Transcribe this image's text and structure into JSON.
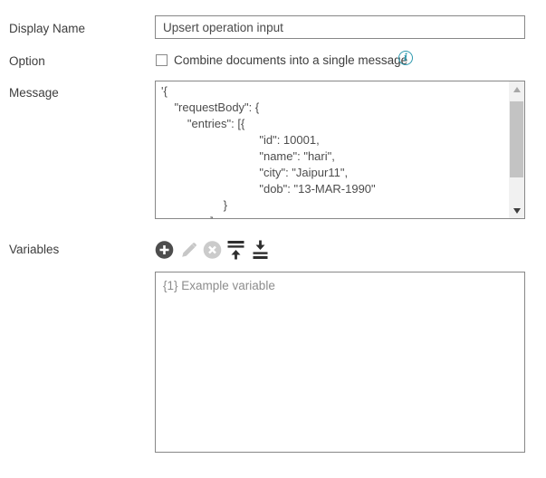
{
  "colors": {
    "border_gray": "#878787",
    "label_text": "#3d3d3d",
    "value_text": "#4a4a4a",
    "muted_text": "#8d8d8d",
    "info_teal": "#2d99ae",
    "icon_dark": "#2e2e2e",
    "icon_disabled": "#c7c7c7",
    "add_button_fill": "#4d4d4d",
    "scrollbar_track": "#f1f1f1",
    "scrollbar_thumb": "#c3c3c3"
  },
  "fields": {
    "display_name": {
      "label": "Display Name",
      "value": "Upsert operation input"
    },
    "option": {
      "label": "Option",
      "checkbox_checked": false,
      "checkbox_label": "Combine documents into a single message",
      "info_icon_glyph": "i"
    },
    "message": {
      "label": "Message",
      "value": "'{\n    \"requestBody\": {\n        \"entries\": [{\n                              \"id\": 10001,\n                              \"name\": \"hari\",\n                              \"city\": \"Jaipur11\",\n                              \"dob\": \"13-MAR-1990\"\n                   }\n               ]"
    },
    "variables": {
      "label": "Variables",
      "toolbar_icons": [
        {
          "name": "add-variable-icon",
          "state": "enabled"
        },
        {
          "name": "edit-variable-icon",
          "state": "disabled"
        },
        {
          "name": "delete-variable-icon",
          "state": "disabled"
        },
        {
          "name": "move-to-top-icon",
          "state": "enabled"
        },
        {
          "name": "move-to-bottom-icon",
          "state": "enabled"
        }
      ],
      "items": [
        {
          "label": "{1} Example variable"
        }
      ]
    }
  }
}
